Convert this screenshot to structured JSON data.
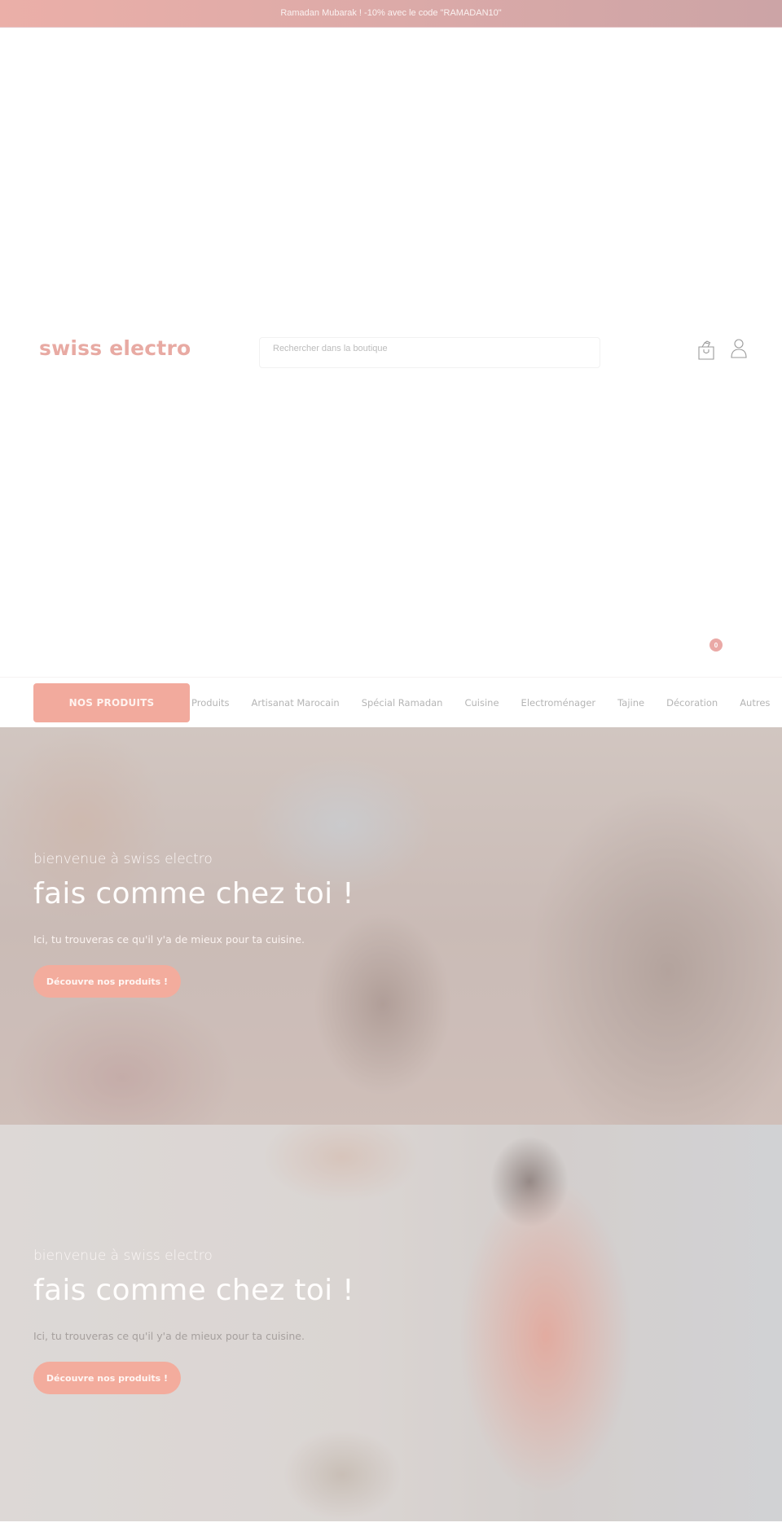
{
  "announcement": {
    "text": "Ramadan Mubarak ! -10% avec le code \"RAMADAN10\""
  },
  "header": {
    "logo": "swiss electro",
    "search_placeholder": "Rechercher dans la boutique",
    "cart_icon": "shopping-bag-icon",
    "account_icon": "user-icon",
    "cart_count": "0"
  },
  "nav": {
    "main_button": "NOS PRODUITS",
    "links": [
      {
        "label": "Produits"
      },
      {
        "label": "Artisanat Marocain"
      },
      {
        "label": "Spécial Ramadan"
      },
      {
        "label": "Cuisine"
      },
      {
        "label": "Electroménager"
      },
      {
        "label": "Tajine"
      },
      {
        "label": "Décoration"
      },
      {
        "label": "Autres"
      }
    ]
  },
  "heroes": [
    {
      "kicker": "bienvenue à swiss electro",
      "title": "fais comme chez toi !",
      "subtitle": "Ici, tu trouveras ce qu'il y'a de mieux pour ta cuisine.",
      "cta": "Découvre nos produits !"
    },
    {
      "kicker": "bienvenue à swiss electro",
      "title": "fais comme chez toi !",
      "subtitle": "Ici, tu trouveras ce qu'il y'a de mieux pour ta cuisine.",
      "cta": "Découvre nos produits !"
    }
  ],
  "colors": {
    "brand": "#e8aaa3",
    "accent_button": "#f2aa9d",
    "badge": "#eaa9a6",
    "nav_text": "#b5b5b5"
  }
}
